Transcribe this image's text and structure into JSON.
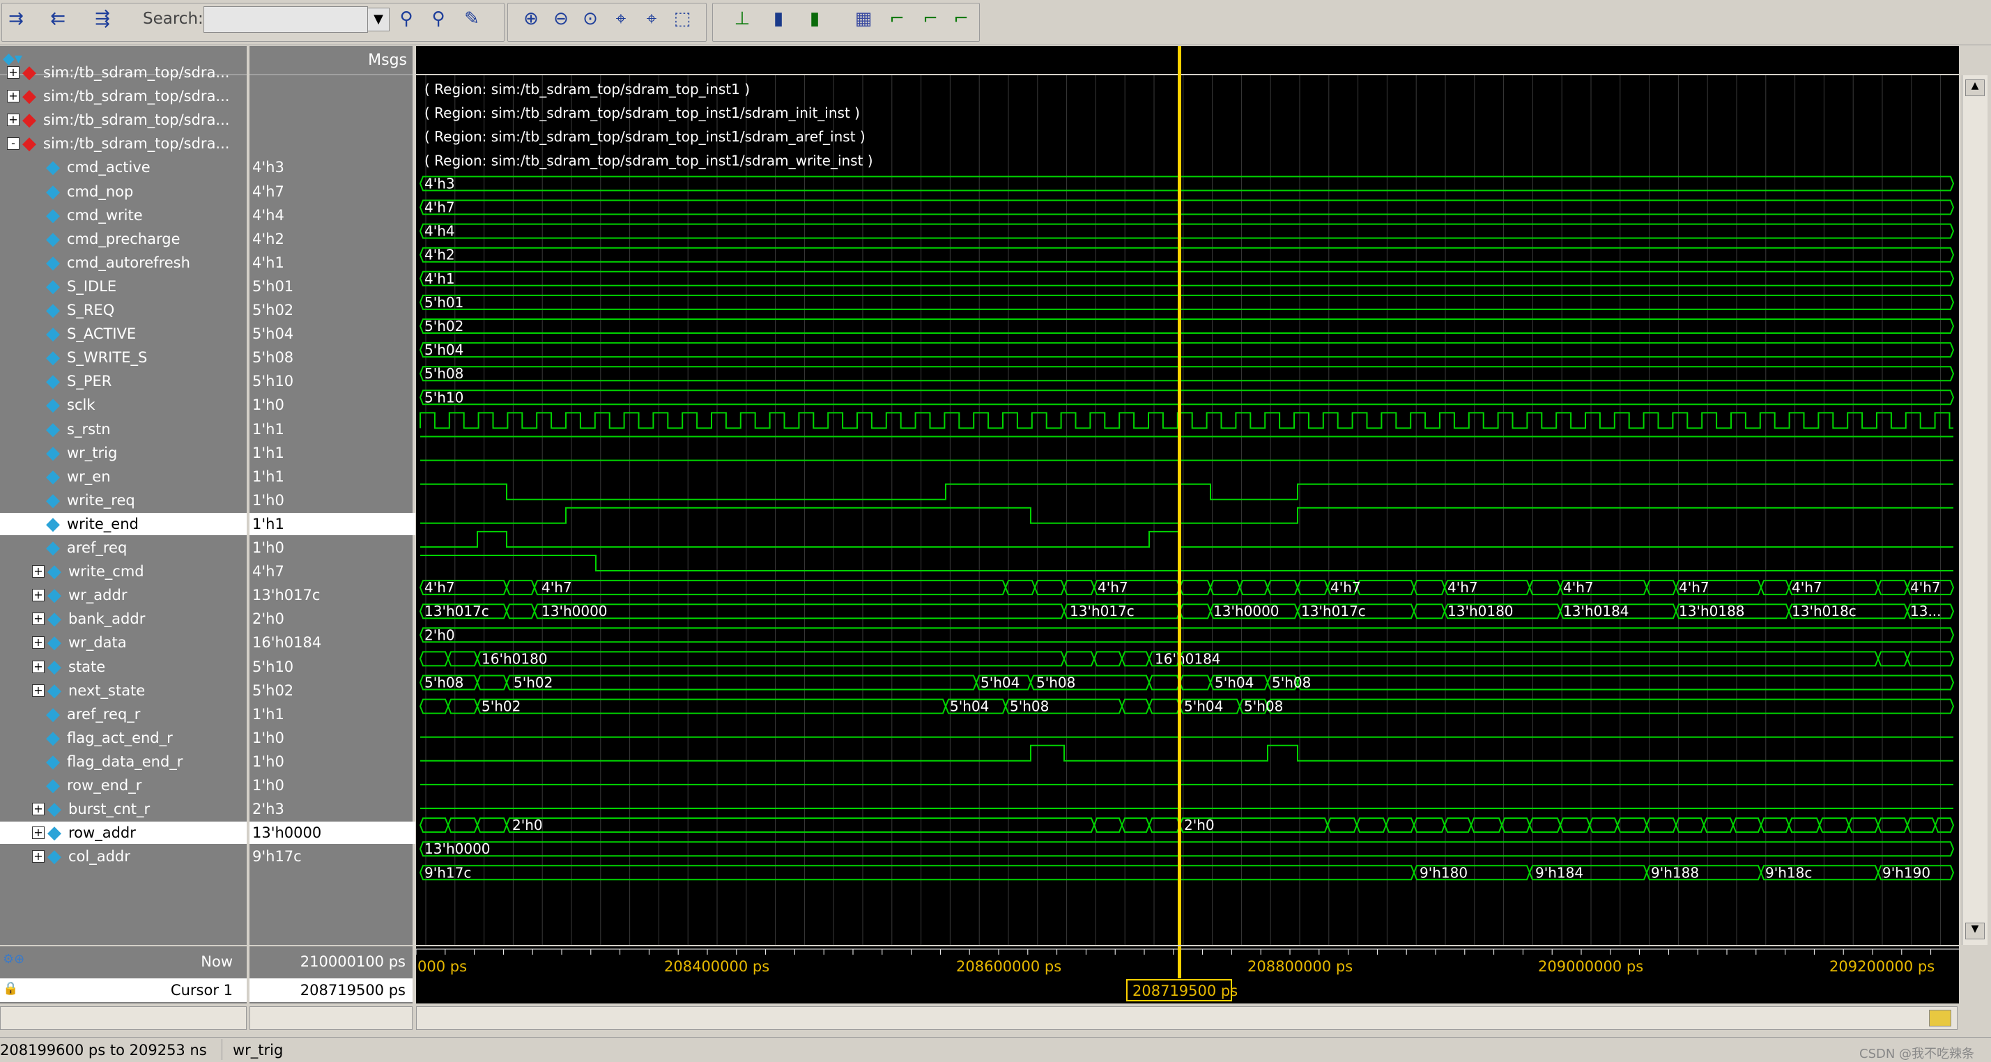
{
  "toolbar": {
    "search_label": "Search:",
    "search_value": ""
  },
  "names_header": "",
  "values_header": "Msgs",
  "signals": [
    {
      "name": "sim:/tb_sdram_top/sdra...",
      "value": "",
      "kind": "region",
      "expand": "+"
    },
    {
      "name": "sim:/tb_sdram_top/sdra...",
      "value": "",
      "kind": "region",
      "expand": "+"
    },
    {
      "name": "sim:/tb_sdram_top/sdra...",
      "value": "",
      "kind": "region",
      "expand": "+"
    },
    {
      "name": "sim:/tb_sdram_top/sdra...",
      "value": "",
      "kind": "region",
      "expand": "-"
    },
    {
      "name": "cmd_active",
      "value": "4'h3",
      "kind": "param"
    },
    {
      "name": "cmd_nop",
      "value": "4'h7",
      "kind": "param"
    },
    {
      "name": "cmd_write",
      "value": "4'h4",
      "kind": "param"
    },
    {
      "name": "cmd_precharge",
      "value": "4'h2",
      "kind": "param"
    },
    {
      "name": "cmd_autorefresh",
      "value": "4'h1",
      "kind": "param"
    },
    {
      "name": "S_IDLE",
      "value": "5'h01",
      "kind": "param"
    },
    {
      "name": "S_REQ",
      "value": "5'h02",
      "kind": "param"
    },
    {
      "name": "S_ACTIVE",
      "value": "5'h04",
      "kind": "param"
    },
    {
      "name": "S_WRITE_S",
      "value": "5'h08",
      "kind": "param"
    },
    {
      "name": "S_PER",
      "value": "5'h10",
      "kind": "param"
    },
    {
      "name": "sclk",
      "value": "1'h0",
      "kind": "in"
    },
    {
      "name": "s_rstn",
      "value": "1'h1",
      "kind": "in"
    },
    {
      "name": "wr_trig",
      "value": "1'h1",
      "kind": "in"
    },
    {
      "name": "wr_en",
      "value": "1'h1",
      "kind": "in"
    },
    {
      "name": "write_req",
      "value": "1'h0",
      "kind": "out"
    },
    {
      "name": "write_end",
      "value": "1'h1",
      "kind": "out",
      "selected": true
    },
    {
      "name": "aref_req",
      "value": "1'h0",
      "kind": "in"
    },
    {
      "name": "write_cmd",
      "value": "4'h7",
      "kind": "out",
      "expand": "+"
    },
    {
      "name": "wr_addr",
      "value": "13'h017c",
      "kind": "out",
      "expand": "+"
    },
    {
      "name": "bank_addr",
      "value": "2'h0",
      "kind": "out",
      "expand": "+"
    },
    {
      "name": "wr_data",
      "value": "16'h0184",
      "kind": "out",
      "expand": "+"
    },
    {
      "name": "state",
      "value": "5'h10",
      "kind": "reg",
      "expand": "+"
    },
    {
      "name": "next_state",
      "value": "5'h02",
      "kind": "reg",
      "expand": "+"
    },
    {
      "name": "aref_req_r",
      "value": "1'h1",
      "kind": "reg"
    },
    {
      "name": "flag_act_end_r",
      "value": "1'h0",
      "kind": "reg"
    },
    {
      "name": "flag_data_end_r",
      "value": "1'h0",
      "kind": "reg"
    },
    {
      "name": "row_end_r",
      "value": "1'h0",
      "kind": "reg"
    },
    {
      "name": "burst_cnt_r",
      "value": "2'h3",
      "kind": "reg",
      "expand": "+"
    },
    {
      "name": "row_addr",
      "value": "13'h0000",
      "kind": "reg",
      "expand": "+",
      "selected": true
    },
    {
      "name": "col_addr",
      "value": "9'h17c",
      "kind": "reg",
      "expand": "+"
    }
  ],
  "region_lines": [
    "( Region: sim:/tb_sdram_top/sdram_top_inst1 )",
    "( Region: sim:/tb_sdram_top/sdram_top_inst1/sdram_init_inst )",
    "( Region: sim:/tb_sdram_top/sdram_top_inst1/sdram_aref_inst )",
    "( Region: sim:/tb_sdram_top/sdram_top_inst1/sdram_write_inst )"
  ],
  "bus_labels": {
    "cmd_active": [
      "4'h3"
    ],
    "cmd_nop": [
      "4'h7"
    ],
    "cmd_write": [
      "4'h4"
    ],
    "cmd_precharge": [
      "4'h2"
    ],
    "cmd_autorefresh": [
      "4'h1"
    ],
    "S_IDLE": [
      "5'h01"
    ],
    "S_REQ": [
      "5'h02"
    ],
    "S_ACTIVE": [
      "5'h04"
    ],
    "S_WRITE_S": [
      "5'h08"
    ],
    "S_PER": [
      "5'h10"
    ],
    "write_cmd": [
      "4'h7",
      "4'h7",
      "4'h7",
      "4'h7",
      "4'h7",
      "4'h7",
      "4'h7",
      "4'h7",
      "4'h7"
    ],
    "wr_addr": [
      "13'h017c",
      "13'h0000",
      "13'h017c",
      "13'h0000",
      "13'h017c",
      "13'h0180",
      "13'h0184",
      "13'h0188",
      "13'h018c",
      "13..."
    ],
    "bank_addr": [
      "2'h0"
    ],
    "wr_data": [
      "16'h0180",
      "16'h0184"
    ],
    "state": [
      "5'h08",
      "5'h02",
      "5'h04",
      "5'h08",
      "5'h04",
      "5'h08"
    ],
    "next_state": [
      "5'h02",
      "5'h04",
      "5'h08",
      "5'h04",
      "5'h08"
    ],
    "burst_cnt_r": [
      "2'h0",
      "2'h0"
    ],
    "row_addr": [
      "13'h0000"
    ],
    "col_addr": [
      "9'h17c",
      "9'h180",
      "9'h184",
      "9'h188",
      "9'h18c",
      "9'h190"
    ]
  },
  "bottom": {
    "now_label": "Now",
    "now_value": "210000100 ps",
    "cursor_label": "Cursor 1",
    "cursor_value": "208719500 ps",
    "time_ticks": [
      "000 ps",
      "208400000 ps",
      "208600000 ps",
      "208800000 ps",
      "209000000 ps",
      "209200000 ps"
    ],
    "cursor_readout": "208719500 ps"
  },
  "status": {
    "range": "208199600 ps to 209253 ns",
    "active_signal": "wr_trig",
    "watermark": "CSDN @我不吃辣条"
  },
  "colors": {
    "wave": "#00d400",
    "cursor": "#ffd200",
    "grid": "#3a3a3a",
    "diamond_blue": "#2aa3d8",
    "diamond_red": "#e02020"
  }
}
